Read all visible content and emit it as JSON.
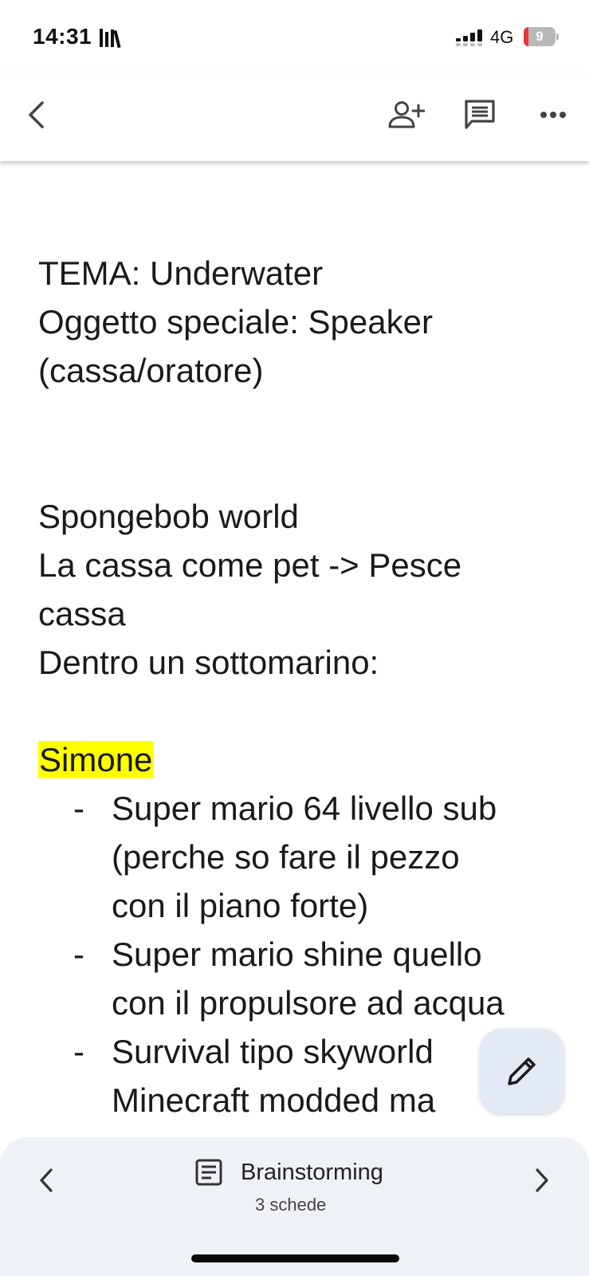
{
  "status_bar": {
    "time": "14:31",
    "network": "4G",
    "battery_level": "9",
    "battery_color": "#e8363a"
  },
  "app_bar": {
    "icons": [
      "back-icon",
      "add-person-icon",
      "comment-icon",
      "more-horiz-icon"
    ]
  },
  "document": {
    "intro_lines": [
      "TEMA: Underwater",
      "Oggetto speciale: Speaker",
      "(cassa/oratore)"
    ],
    "idea_lines": [
      "Spongebob world",
      "La cassa come pet -> Pesce",
      "cassa",
      "Dentro un sottomarino:"
    ],
    "section_heading": "Simone",
    "highlight_color": "#ffff00",
    "bullet_marker": "-",
    "bullets": [
      {
        "lines": [
          "Super mario 64 livello sub",
          "(perche so fare il pezzo",
          "con il piano forte)"
        ]
      },
      {
        "lines": [
          "Super mario shine quello",
          "con il propulsore ad acqua"
        ]
      },
      {
        "lines": [
          "Survival tipo skyworld",
          "Minecraft modded ma"
        ]
      }
    ]
  },
  "fab": {
    "icon": "pencil-icon"
  },
  "bottom_bar": {
    "title": "Brainstorming",
    "subtitle": "3 schede",
    "icons": [
      "chevron-left-icon",
      "document-icon",
      "chevron-right-icon"
    ]
  }
}
